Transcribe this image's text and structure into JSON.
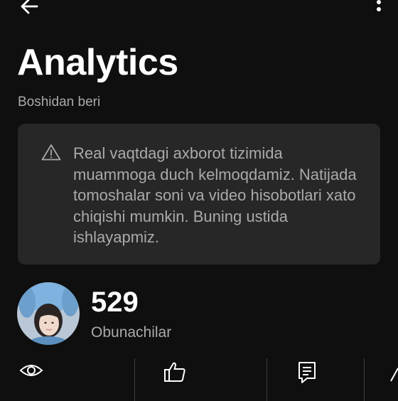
{
  "header": {
    "back_icon": "arrow-left-icon",
    "menu_icon": "more-vertical-icon"
  },
  "page": {
    "title": "Analytics",
    "subtitle": "Boshidan beri"
  },
  "notice": {
    "icon": "warning-triangle-icon",
    "text": "Real vaqtdagi axborot tizimida muammoga duch kelmoqdamiz. Natijada tomoshalar soni va video hisobotlari xato chiqishi mumkin. Buning ustida ishlayapmiz."
  },
  "channel": {
    "subscriber_count": "529",
    "subscriber_label": "Obunachilar"
  },
  "stats": [
    {
      "icon": "eye-icon",
      "value": ""
    },
    {
      "icon": "thumbs-up-icon",
      "value": ""
    },
    {
      "icon": "comment-icon",
      "value": ""
    },
    {
      "icon": "share-icon",
      "value": ""
    }
  ],
  "colors": {
    "background": "#0f0f0f",
    "card": "#272727",
    "secondary_text": "#aaaaaa",
    "primary_text": "#ffffff"
  }
}
